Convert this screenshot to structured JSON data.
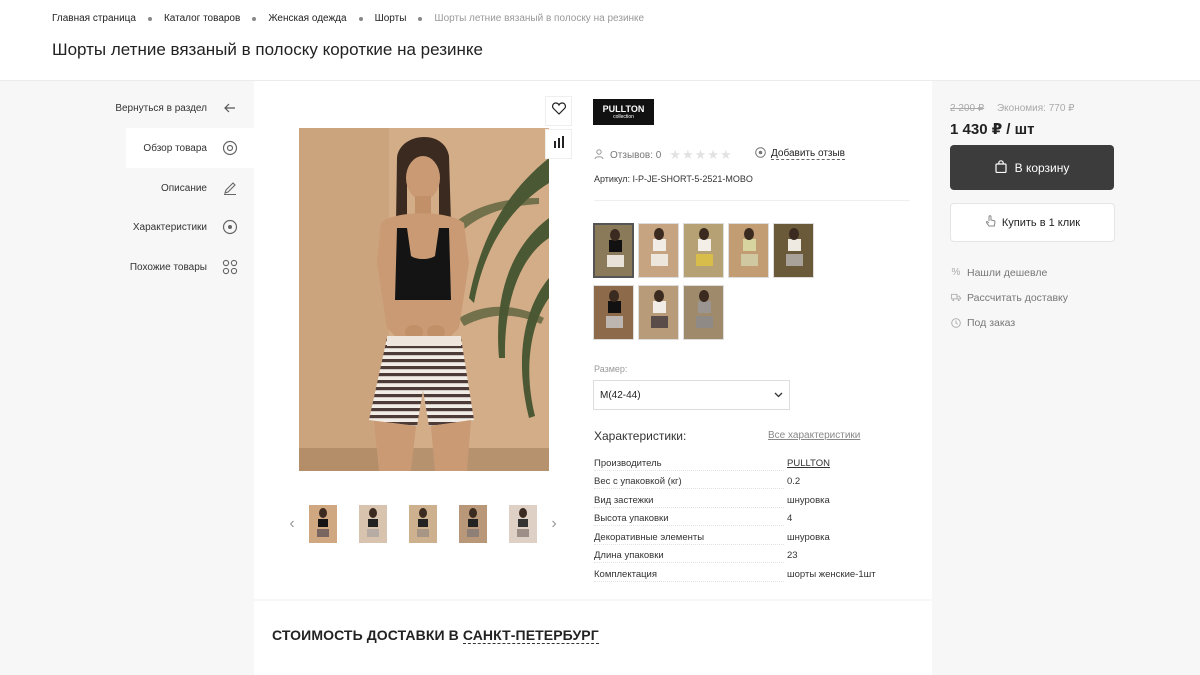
{
  "breadcrumbs": [
    "Главная страница",
    "Каталог товаров",
    "Женская одежда",
    "Шорты",
    "Шорты летние вязаный в полоску на резинке"
  ],
  "title": "Шорты летние вязаный в полоску короткие на резинке",
  "sidenav": {
    "back": "Вернуться в раздел",
    "overview": "Обзор товара",
    "description": "Описание",
    "characteristics": "Характеристики",
    "similar": "Похожие товары"
  },
  "brand": {
    "name": "PULLTON",
    "sub": "collection"
  },
  "reviews": {
    "label": "Отзывов: 0",
    "stars": "★★★★★",
    "add": "Добавить отзыв"
  },
  "sku": "Артикул: I-P-JE-SHORT-5-2521-MOBO",
  "size": {
    "label": "Размер:",
    "value": "M(42-44)"
  },
  "chars": {
    "title": "Характеристики:",
    "all_link": "Все характеристики",
    "rows": [
      {
        "k": "Производитель",
        "v": "PULLTON"
      },
      {
        "k": "Вес с упаковкой (кг)",
        "v": "0.2"
      },
      {
        "k": "Вид застежки",
        "v": "шнуровка"
      },
      {
        "k": "Высота упаковки",
        "v": "4"
      },
      {
        "k": "Декоративные элементы",
        "v": "шнуровка"
      },
      {
        "k": "Длина упаковки",
        "v": "23"
      },
      {
        "k": "Комплектация",
        "v": "шорты женские-1шт"
      }
    ]
  },
  "delivery": {
    "prefix": "СТОИМОСТЬ ДОСТАВКИ В",
    "city": "САНКТ-ПЕТЕРБУРГ"
  },
  "buy": {
    "old_price": "2 200 ₽",
    "economy": "Экономия: 770 ₽",
    "price": "1 430 ₽ / шт",
    "cart": "В корзину",
    "one_click": "Купить в 1 клик",
    "cheaper": "Нашли дешевле",
    "calc_delivery": "Рассчитать доставку",
    "preorder": "Под заказ"
  },
  "colors": {
    "skin": "#c89a74",
    "hair": "#3a2a20",
    "top_black": "#141414",
    "stripes": "#6a5550",
    "bg_warm": "#d2ac87",
    "leaf": "#3c4f2a"
  }
}
